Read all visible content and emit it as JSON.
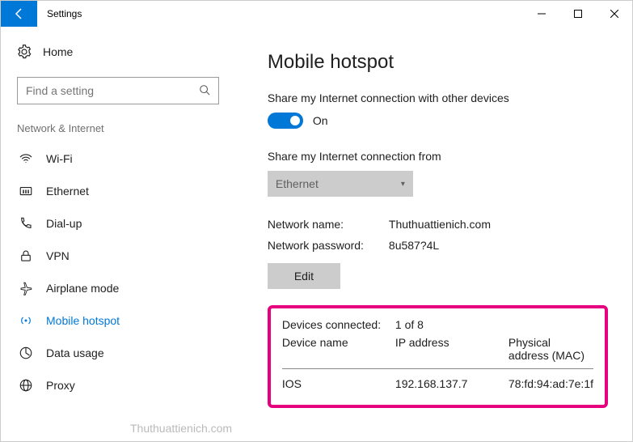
{
  "titlebar": {
    "title": "Settings"
  },
  "sidebar": {
    "home": "Home",
    "search_placeholder": "Find a setting",
    "category": "Network & Internet",
    "items": [
      {
        "label": "Wi-Fi"
      },
      {
        "label": "Ethernet"
      },
      {
        "label": "Dial-up"
      },
      {
        "label": "VPN"
      },
      {
        "label": "Airplane mode"
      },
      {
        "label": "Mobile hotspot"
      },
      {
        "label": "Data usage"
      },
      {
        "label": "Proxy"
      }
    ]
  },
  "main": {
    "title": "Mobile hotspot",
    "share_label": "Share my Internet connection with other devices",
    "toggle_state": "On",
    "share_from_label": "Share my Internet connection from",
    "share_from_value": "Ethernet",
    "network_name_label": "Network name:",
    "network_name_value": "Thuthuattienich.com",
    "network_password_label": "Network password:",
    "network_password_value": "8u587?4L",
    "edit_label": "Edit",
    "devices": {
      "connected_label": "Devices connected:",
      "connected_value": "1 of 8",
      "col_name": "Device name",
      "col_ip": "IP address",
      "col_mac": "Physical address (MAC)",
      "rows": [
        {
          "name": "IOS",
          "ip": "192.168.137.7",
          "mac": "78:fd:94:ad:7e:1f"
        }
      ]
    }
  },
  "watermark": "Thuthuattienich.com"
}
